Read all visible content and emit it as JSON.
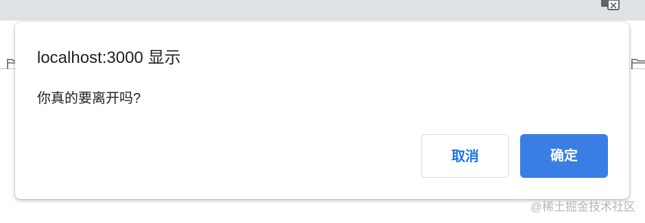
{
  "dialog": {
    "title": "localhost:3000 显示",
    "message": "你真的要离开吗?",
    "cancel_label": "取消",
    "ok_label": "确定"
  },
  "watermark": "@稀土掘金技术社区",
  "icons": {
    "translate": "translate-icon",
    "bookmark_folder": "folder-icon"
  },
  "colors": {
    "primary_button": "#3a7ee5",
    "cancel_text": "#1a73e8",
    "tabstrip": "#dee1e6"
  }
}
